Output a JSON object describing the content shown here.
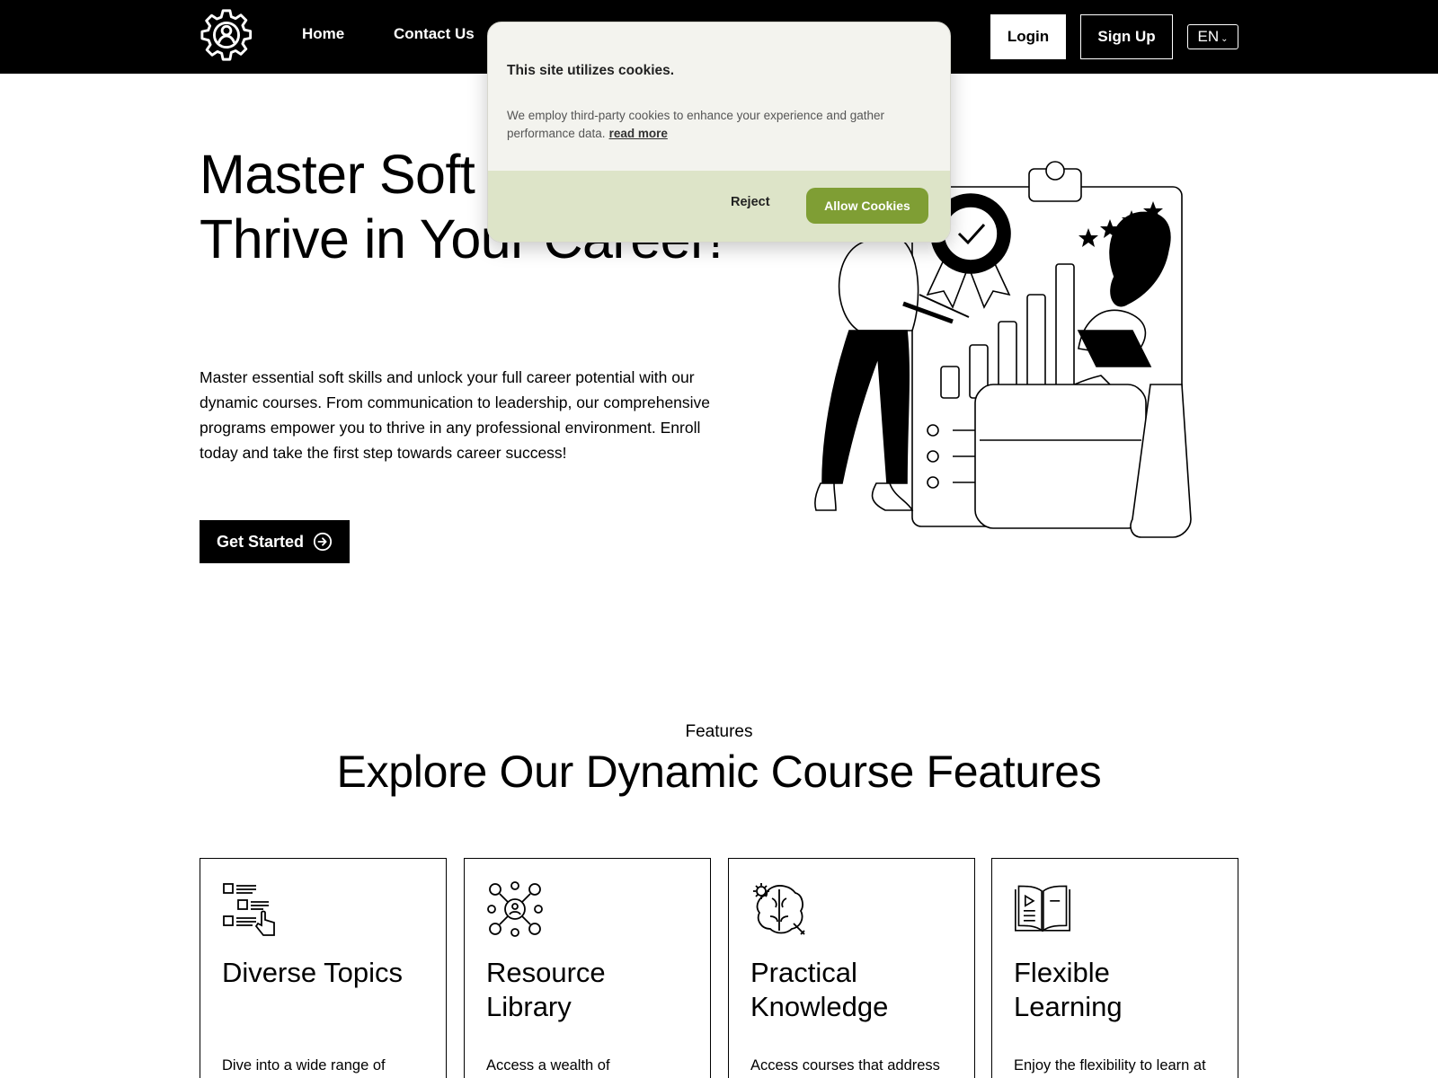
{
  "nav": {
    "home": "Home",
    "contact": "Contact Us",
    "login": "Login",
    "signup": "Sign Up",
    "language": "EN",
    "logo_icon": "gear-user-icon"
  },
  "hero": {
    "title": "Master Soft Skills, Thrive in Your Career!",
    "description": "Master essential soft skills and unlock your full career potential with our dynamic courses. From communication to leadership, our comprehensive programs empower you to thrive in any professional environment. Enroll today and take the first step towards career success!",
    "cta": "Get Started",
    "cta_icon": "arrow-right-circle-icon"
  },
  "cookie": {
    "title": "This site utilizes cookies.",
    "text": "We employ third-party cookies to enhance your experience and gather performance data.",
    "read_more": "read more",
    "reject": "Reject",
    "allow": "Allow Cookies",
    "accent": "#7f9e34",
    "footer_bg": "#dde4c8"
  },
  "features": {
    "kicker": "Features",
    "heading": "Explore Our Dynamic Course Features",
    "cards": [
      {
        "title": "Diverse Topics",
        "text": "Dive into a wide range of topics spanning",
        "icon": "numbered-list-icon"
      },
      {
        "title": "Resource Library",
        "text": "Access a wealth of supplementary resources",
        "icon": "network-people-icon"
      },
      {
        "title": "Practical Knowledge",
        "text": "Access courses that address current industry trends and",
        "icon": "brain-gear-icon"
      },
      {
        "title": "Flexible Learning",
        "text": "Enjoy the flexibility to learn at your own pace, with on-",
        "icon": "open-book-video-icon"
      }
    ]
  }
}
